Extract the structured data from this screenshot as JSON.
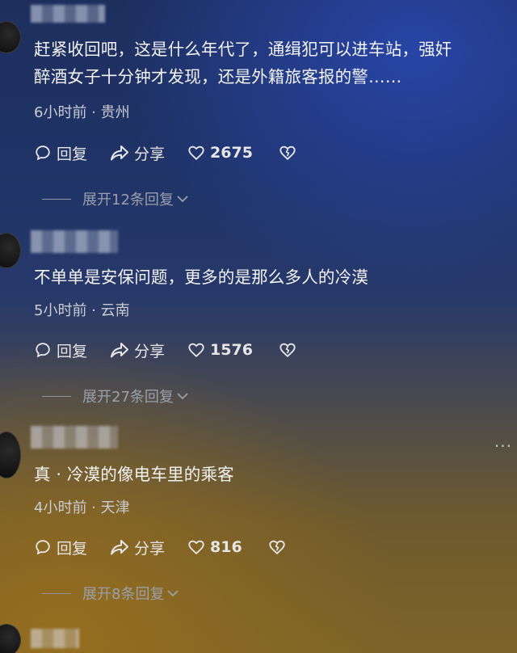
{
  "comments": [
    {
      "text_line1": "赶紧收回吧，这是什么年代了，通缉犯可以进车站，强奸",
      "text_line2": "醉酒女子十分钟才发现，还是外籍旅客报的警……",
      "meta": "6小时前 · 贵州",
      "reply_label": "回复",
      "share_label": "分享",
      "likes": "2675",
      "expand_label": "展开12条回复"
    },
    {
      "text_line1": "不单单是安保问题，更多的是那么多人的冷漠",
      "meta": "5小时前 · 云南",
      "reply_label": "回复",
      "share_label": "分享",
      "likes": "1576",
      "expand_label": "展开27条回复"
    },
    {
      "text_line1": "真 · 冷漠的像电车里的乘客",
      "meta": "4小时前 · 天津",
      "reply_label": "回复",
      "share_label": "分享",
      "likes": "816",
      "expand_label": "展开8条回复"
    }
  ],
  "more_menu": "···"
}
